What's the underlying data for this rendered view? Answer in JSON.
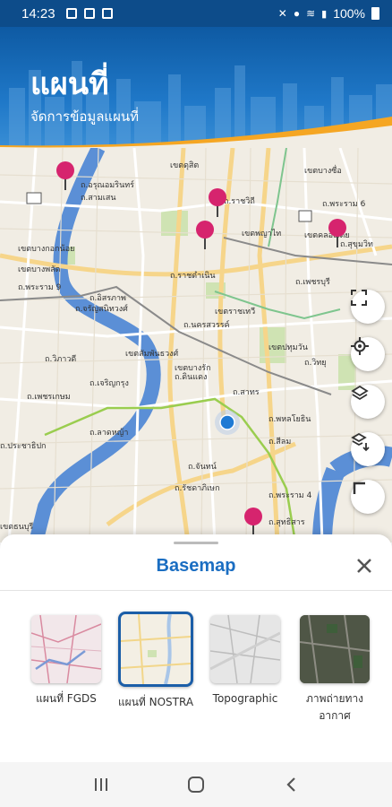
{
  "status_bar": {
    "time": "14:23",
    "battery": "100%"
  },
  "header": {
    "title": "แผนที่",
    "subtitle": "จัดการข้อมูลแผนที่"
  },
  "map": {
    "labels": [
      {
        "text": "เขตดุสิต"
      },
      {
        "text": "เขตบางซื่อ"
      },
      {
        "text": "ถ.สามเสน"
      },
      {
        "text": "ถ.ราชวิถี"
      },
      {
        "text": "ถ.พระราม 6"
      },
      {
        "text": "เขตพญาไท"
      },
      {
        "text": "ถ.เพชรบุรี"
      },
      {
        "text": "เขตราชเทวี"
      },
      {
        "text": "เขตปทุมวัน"
      },
      {
        "text": "ถ.สาทร"
      },
      {
        "text": "เขตบางรัก"
      },
      {
        "text": "ถ.สีลม"
      },
      {
        "text": "เขตสัมพันธวงศ์"
      },
      {
        "text": "ถ.เจริญกรุง"
      },
      {
        "text": "ถ.จันทน์"
      },
      {
        "text": "ถ.พระราม 4"
      },
      {
        "text": "เขตคลองเตย"
      },
      {
        "text": "ถ.สุขุมวิท"
      },
      {
        "text": "ถ.วิทยุ"
      },
      {
        "text": "ถ.อรุณอมรินทร์"
      },
      {
        "text": "ถ.จรัญสนิทวงศ์"
      },
      {
        "text": "เขตบางกอกน้อย"
      },
      {
        "text": "ถ.อิสรภาพ"
      },
      {
        "text": "ถ.เพชรเกษม"
      },
      {
        "text": "เขตบางพลัด"
      },
      {
        "text": "ถ.ประชาธิปก"
      },
      {
        "text": "ถ.ลาดหญ้า"
      },
      {
        "text": "เขตธนบุรี"
      },
      {
        "text": "ถ.รัชดาภิเษก"
      },
      {
        "text": "ถ.ราชดำเนิน"
      },
      {
        "text": "ถ.นครสวรรค์"
      },
      {
        "text": "ถ.พหลโยธิน"
      },
      {
        "text": "ถ.วิภาวดี"
      },
      {
        "text": "ถ.พระราม 9"
      },
      {
        "text": "ถ.ดินแดง"
      },
      {
        "text": "ถ.สุทธิสาร"
      }
    ],
    "buttons": {
      "fullscreen": "fullscreen-icon",
      "locate": "locate-icon",
      "layers": "layers-icon",
      "layers_download": "layers-download-icon",
      "measure": "corner-icon"
    }
  },
  "basemap_sheet": {
    "title": "Basemap",
    "options": [
      {
        "label": "แผนที่ FGDS",
        "selected": false
      },
      {
        "label": "แผนที่ NOSTRA",
        "selected": true
      },
      {
        "label": "Topographic",
        "selected": false
      },
      {
        "label": "ภาพถ่ายทาง อากาศ",
        "selected": false
      }
    ]
  },
  "colors": {
    "header_blue": "#1f78c8",
    "accent_orange": "#f5a623",
    "title_blue": "#1b6ec2",
    "pin_magenta": "#d6246e",
    "river_blue": "#5b8fd6"
  }
}
